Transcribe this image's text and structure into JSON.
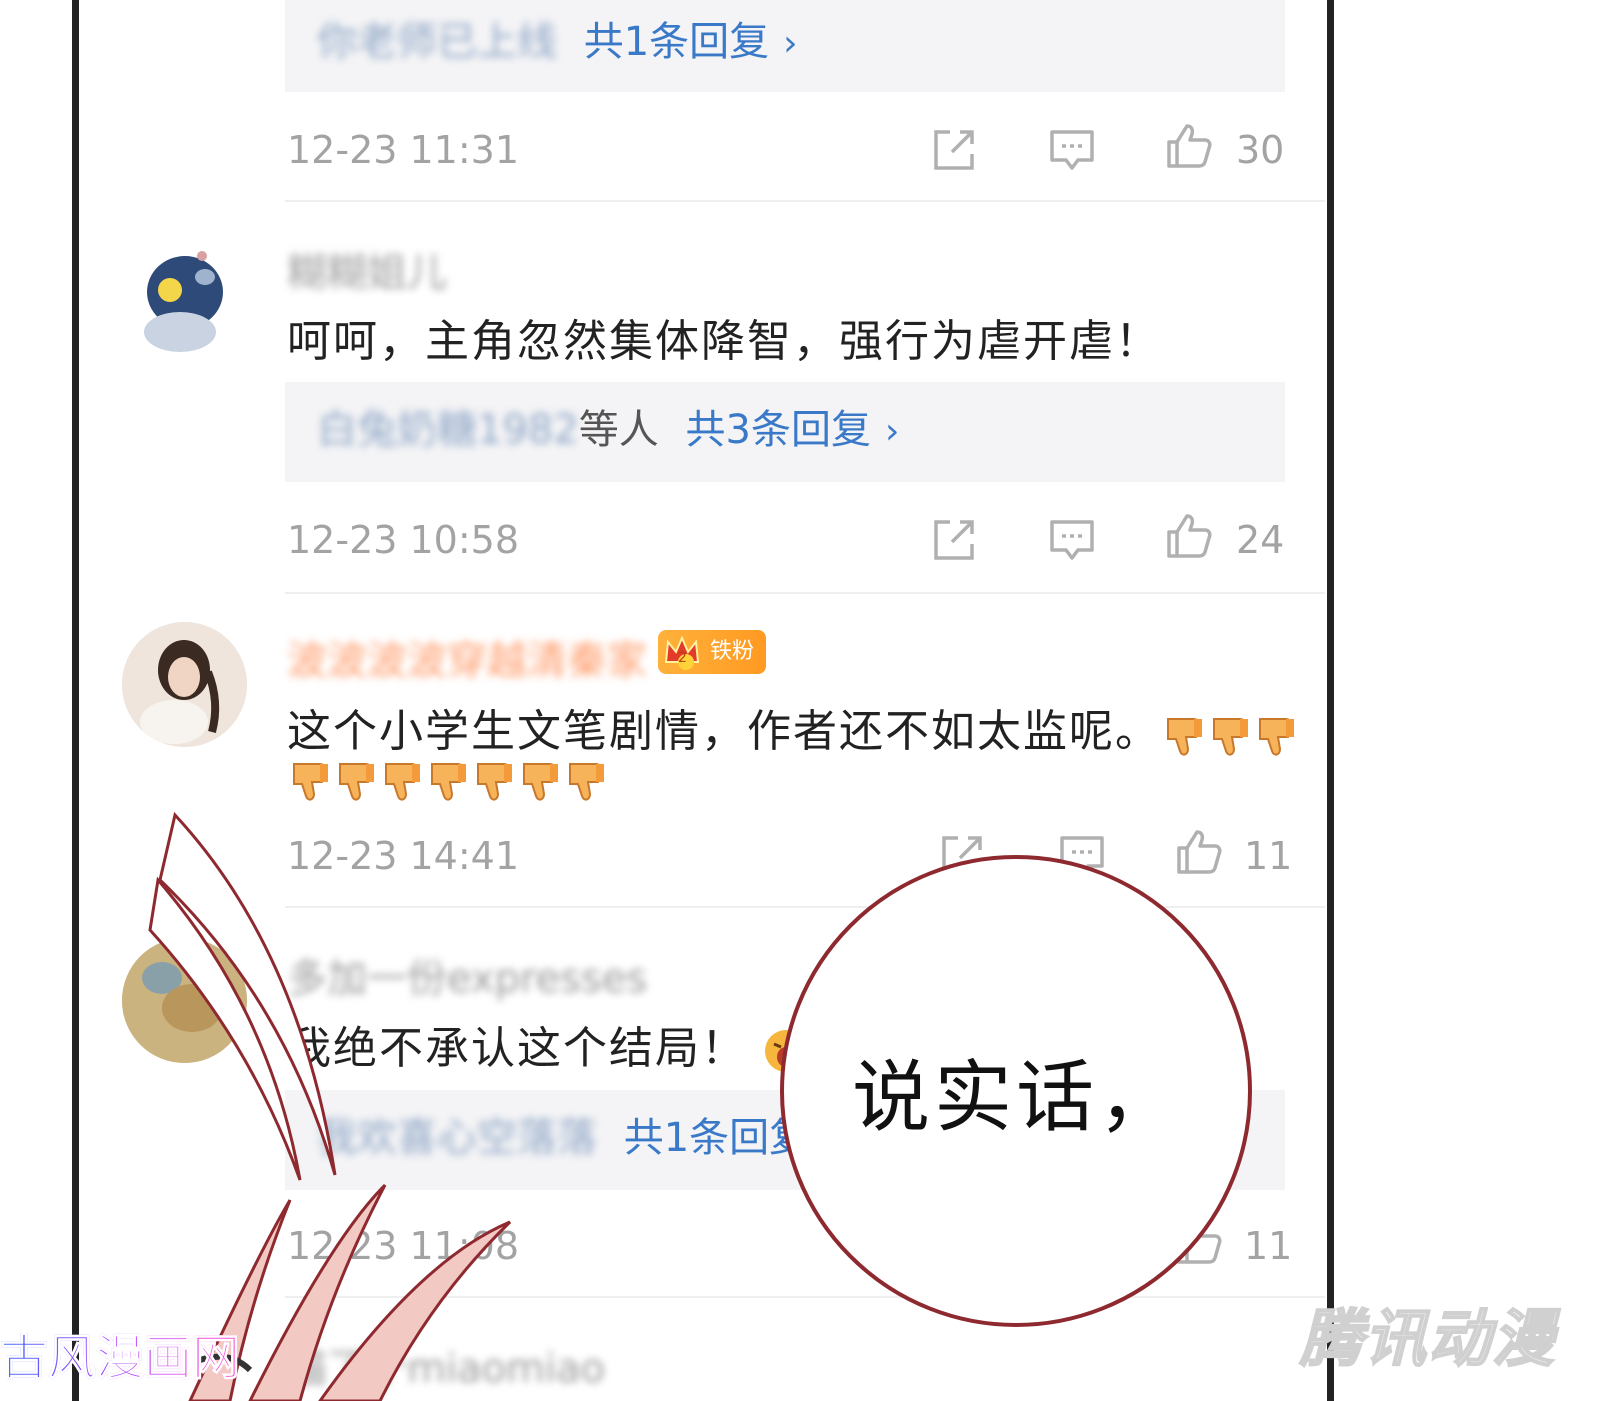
{
  "comments": [
    {
      "reply_preview_names": "你老师已上线",
      "reply_count_label": "共1条回复",
      "chevron": "›",
      "time": "12-23 11:31",
      "likes": "30"
    },
    {
      "username": "糊糊姐儿",
      "text": "呵呵，主角忽然集体降智，强行为虐开虐！",
      "reply_preview_names": "白兔奶糖1982",
      "reply_preview_suffix": "等人",
      "reply_count_label": "共3条回复",
      "chevron": "›",
      "time": "12-23 10:58",
      "likes": "24"
    },
    {
      "username": "波波波波穿越清秦家",
      "badge_label": "铁粉",
      "badge_level": "2",
      "text": "这个小学生文笔剧情，作者还不如太监呢。",
      "emoji_name": "thumbs-down-emoji",
      "emoji_count_line1": 3,
      "emoji_count_line2": 7,
      "time": "12-23 14:41",
      "likes": "11"
    },
    {
      "username": "多加一份expresses",
      "text": "我绝不承认这个结局！",
      "emoji_name": "screaming-face-emoji",
      "reply_preview_names": "我欢喜心空落落",
      "reply_count_label": "共1条回复",
      "chevron": "›",
      "time": "12-23 11:08",
      "likes": "11"
    },
    {
      "username": "喵了个miaomiao"
    }
  ],
  "speech_bubble": {
    "text": "说实话，"
  },
  "watermarks": {
    "left": "古风漫画网",
    "right": "腾讯动漫"
  },
  "colors": {
    "link_blue": "#3a79c8",
    "meta_gray": "#a3a3a3",
    "reply_bg": "#f4f4f6",
    "bubble_border": "#8e2a2f",
    "badge_orange": "#ff9a22"
  },
  "icons": [
    "share-icon",
    "comment-icon",
    "like-icon"
  ]
}
